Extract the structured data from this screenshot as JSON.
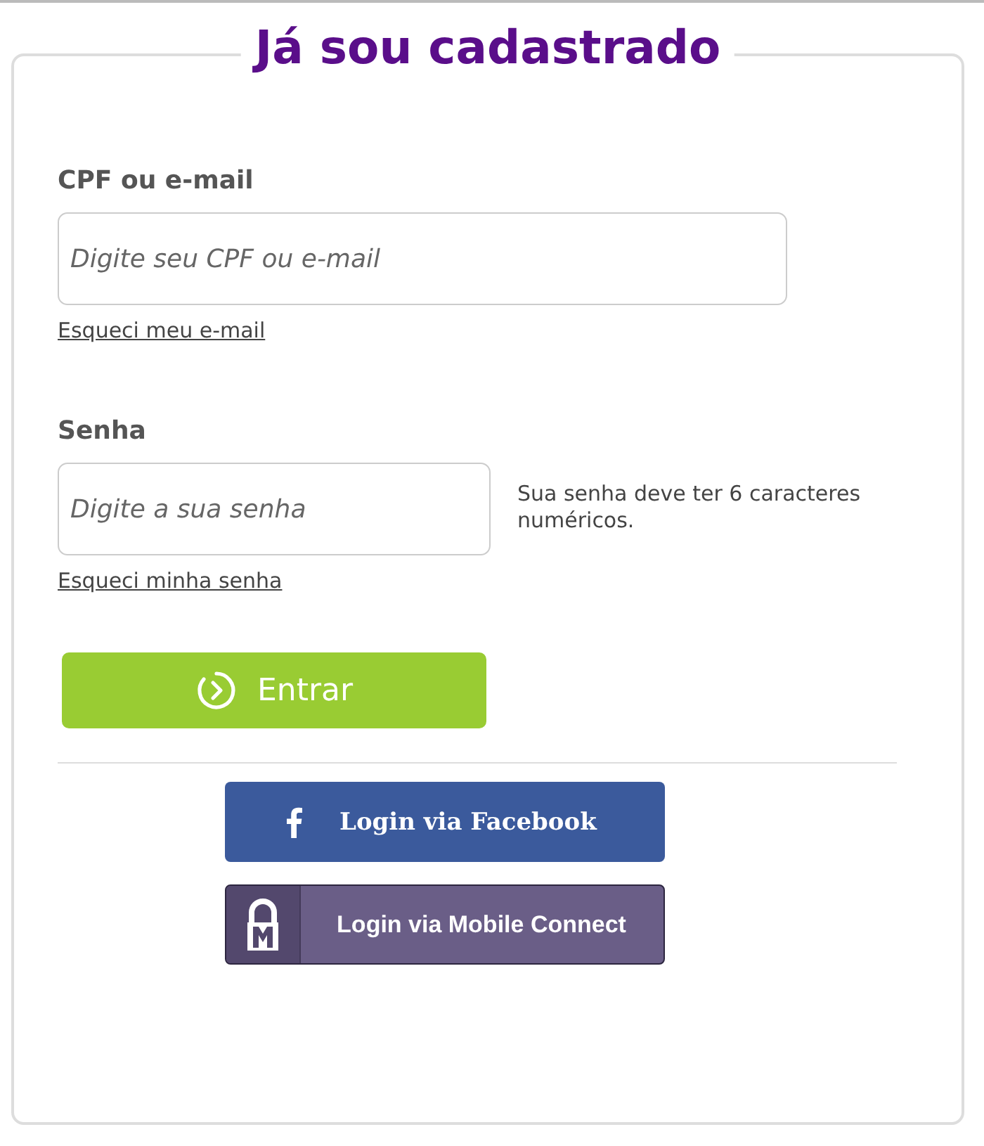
{
  "title": "Já sou cadastrado",
  "fields": [
    {
      "label": "CPF ou e-mail",
      "placeholder": "Digite seu CPF ou e-mail",
      "kind": "text",
      "link": "Esqueci meu e-mail"
    },
    {
      "label": "Senha",
      "placeholder": "Digite a sua senha",
      "kind": "password",
      "hint": "Sua senha deve ter 6 caracteres numéricos.",
      "link": "Esqueci minha senha"
    }
  ],
  "submit": {
    "label": "Entrar"
  },
  "social": [
    {
      "kind": "facebook",
      "label": "Login via Facebook"
    },
    {
      "kind": "mobile-connect",
      "label": "Login via Mobile Connect"
    }
  ]
}
